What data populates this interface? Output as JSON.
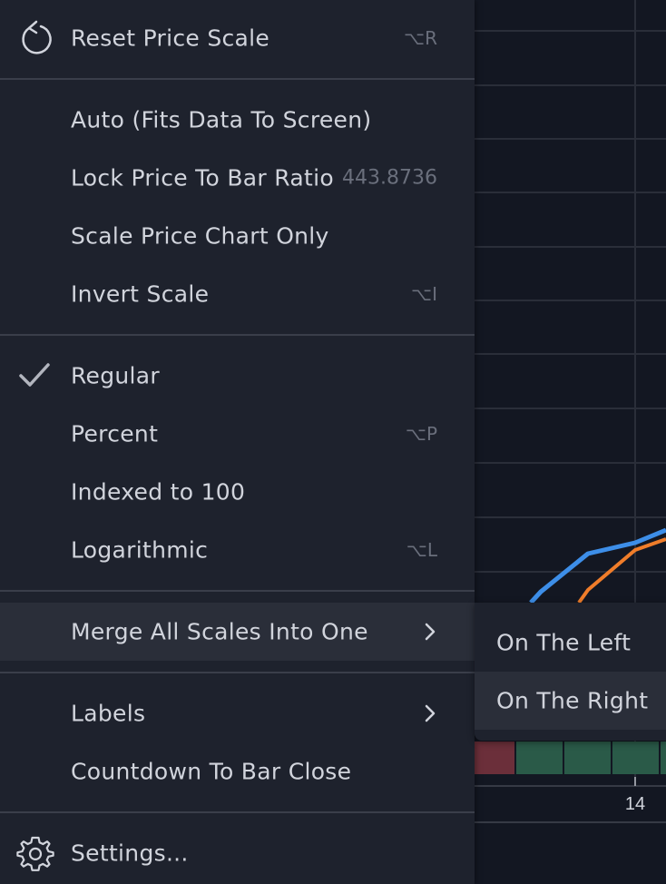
{
  "menu": {
    "reset": {
      "label": "Reset Price Scale",
      "shortcut": "⌥R",
      "icon": "reset-icon"
    },
    "auto": {
      "label": "Auto (Fits Data To Screen)"
    },
    "lock": {
      "label": "Lock Price To Bar Ratio",
      "value": "443.8736"
    },
    "scale_price": {
      "label": "Scale Price Chart Only"
    },
    "invert": {
      "label": "Invert Scale",
      "shortcut": "⌥I"
    },
    "regular": {
      "label": "Regular",
      "checked": true,
      "icon": "checkmark-icon"
    },
    "percent": {
      "label": "Percent",
      "shortcut": "⌥P"
    },
    "indexed": {
      "label": "Indexed to 100"
    },
    "log": {
      "label": "Logarithmic",
      "shortcut": "⌥L"
    },
    "merge": {
      "label": "Merge All Scales Into One",
      "icon": "chevron-right-icon",
      "highlighted": true
    },
    "labels": {
      "label": "Labels",
      "icon": "chevron-right-icon"
    },
    "countdown": {
      "label": "Countdown To Bar Close"
    },
    "settings": {
      "label": "Settings...",
      "icon": "gear-icon"
    }
  },
  "submenu": {
    "left": {
      "label": "On The Left"
    },
    "right": {
      "label": "On The Right"
    }
  },
  "chart": {
    "time_label": "14",
    "colors": {
      "background": "#131722",
      "grid": "#2a2e39",
      "line_blue": "#3d8ee8",
      "line_orange": "#f07d2a",
      "volume_red": "#6b2f3a",
      "volume_green": "#2a5a48"
    }
  }
}
